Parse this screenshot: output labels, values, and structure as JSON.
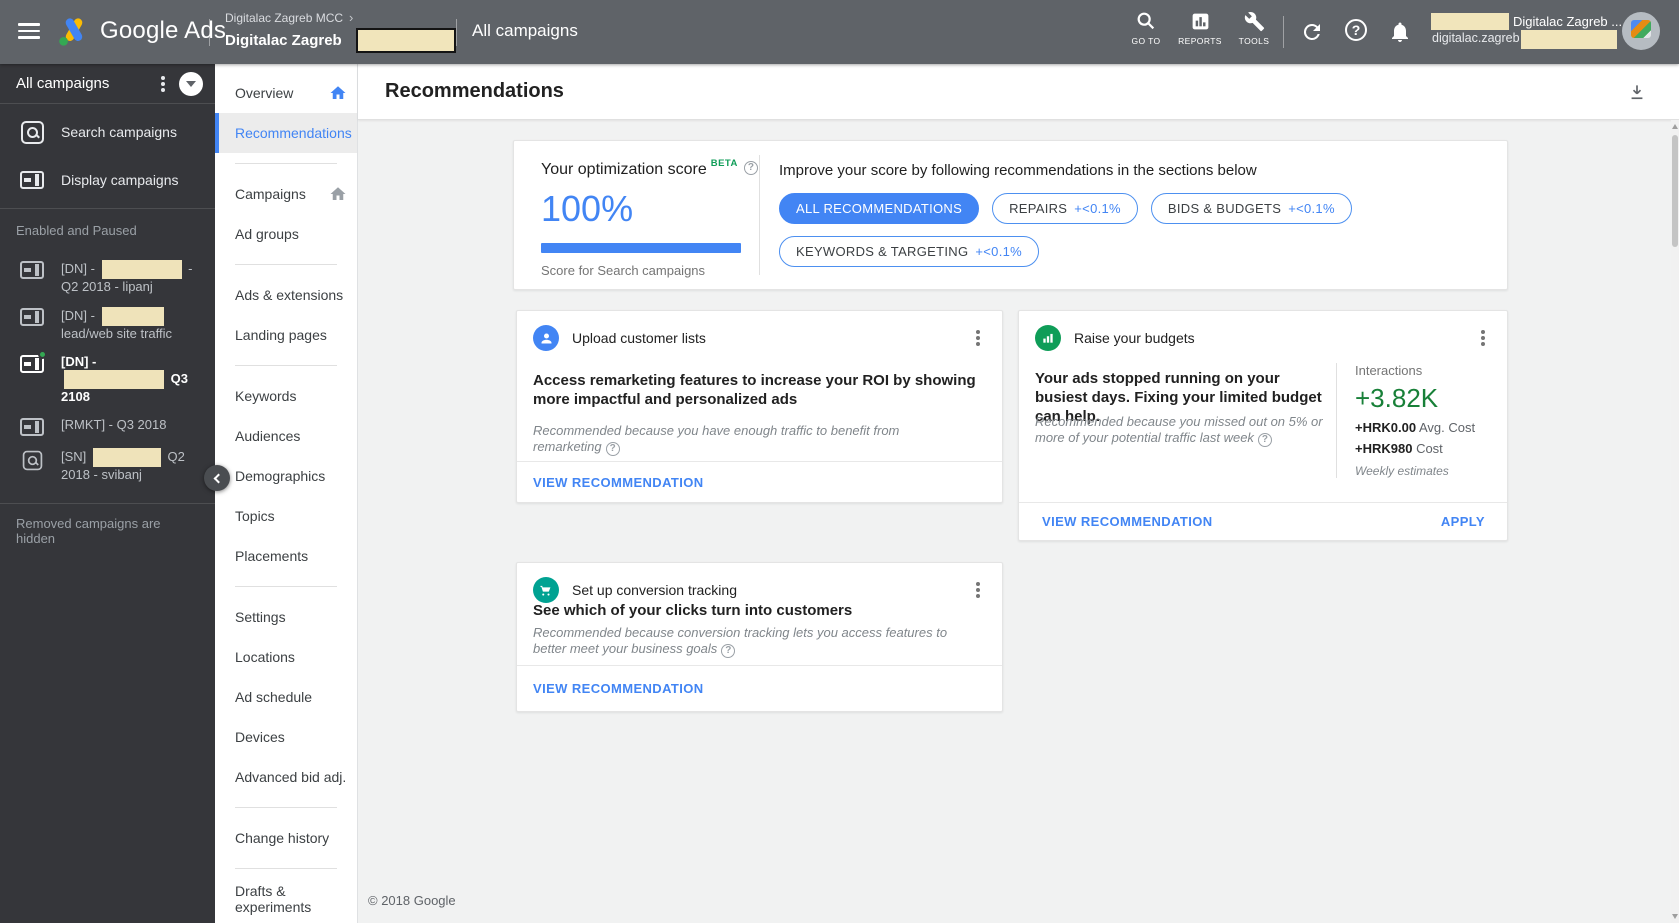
{
  "topbar": {
    "brand": "Google Ads",
    "breadcrumb": {
      "parent": "Digitalac Zagreb MCC",
      "chevron": "›",
      "current": "Digitalac Zagreb"
    },
    "section_title": "All campaigns",
    "nav_tools": [
      {
        "id": "goto",
        "icon": "search-icon",
        "label": "GO TO"
      },
      {
        "id": "reports",
        "icon": "bar-chart-icon",
        "label": "REPORTS"
      },
      {
        "id": "tools",
        "icon": "wrench-icon",
        "label": "TOOLS"
      }
    ],
    "account": {
      "display_name": "Digitalac Zagreb ...",
      "email_prefix": "digitalac.zagreb"
    }
  },
  "campaign_panel": {
    "header_title": "All campaigns",
    "filters": [
      {
        "label": "Search campaigns",
        "type": "search"
      },
      {
        "label": "Display campaigns",
        "type": "display"
      }
    ],
    "section_label": "Enabled and Paused",
    "campaigns": [
      {
        "icon": "display",
        "before": "[DN] -",
        "redacted": true,
        "redact_w": 80,
        "after": "- Q2 2018 - lipanj",
        "active": false
      },
      {
        "icon": "display",
        "before": "[DN] -",
        "redacted": true,
        "redact_w": 62,
        "after": "lead/web site traffic",
        "active": false
      },
      {
        "icon": "display",
        "before": "[DN] -",
        "redacted": true,
        "redact_w": 100,
        "after": "Q3 2108",
        "active": true
      },
      {
        "icon": "display",
        "before": "[RMKT] - Q3 2018",
        "redacted": false,
        "redact_w": 0,
        "after": "",
        "active": false
      },
      {
        "icon": "search",
        "before": "[SN]",
        "redacted": true,
        "redact_w": 68,
        "after": "Q2 2018 - svibanj",
        "active": false
      }
    ],
    "note": "Removed campaigns are hidden"
  },
  "side_nav": {
    "items": [
      {
        "label": "Overview",
        "home": "blue"
      },
      {
        "label": "Recommendations",
        "selected": true
      },
      {
        "divider": true
      },
      {
        "label": "Campaigns",
        "home": "gray"
      },
      {
        "label": "Ad groups"
      },
      {
        "divider": true
      },
      {
        "label": "Ads & extensions"
      },
      {
        "label": "Landing pages"
      },
      {
        "divider": true
      },
      {
        "label": "Keywords"
      },
      {
        "label": "Audiences"
      },
      {
        "label": "Demographics"
      },
      {
        "label": "Topics"
      },
      {
        "label": "Placements"
      },
      {
        "divider": true
      },
      {
        "label": "Settings"
      },
      {
        "label": "Locations"
      },
      {
        "label": "Ad schedule"
      },
      {
        "label": "Devices"
      },
      {
        "label": "Advanced bid adj."
      },
      {
        "divider": true
      },
      {
        "label": "Change history"
      },
      {
        "divider": true
      },
      {
        "label": "Drafts & experiments"
      }
    ]
  },
  "page": {
    "title": "Recommendations",
    "copyright": "© 2018 Google"
  },
  "score_card": {
    "title": "Your optimization score",
    "beta_tag": "BETA",
    "score": "100%",
    "caption": "Score for Search campaigns",
    "improve_heading": "Improve your score by following recommendations in the sections below",
    "chips": [
      {
        "label": "ALL RECOMMENDATIONS",
        "delta": "",
        "selected": true
      },
      {
        "label": "REPAIRS",
        "delta": "+<0.1%",
        "selected": false
      },
      {
        "label": "BIDS & BUDGETS",
        "delta": "+<0.1%",
        "selected": false
      },
      {
        "label": "KEYWORDS & TARGETING",
        "delta": "+<0.1%",
        "selected": false
      }
    ]
  },
  "cards": {
    "upload": {
      "title": "Upload customer lists",
      "heading": "Access remarketing features to increase your ROI by showing more impactful and personalized ads",
      "reason": "Recommended because you have enough traffic to benefit from remarketing",
      "action": "VIEW RECOMMENDATION"
    },
    "budget": {
      "title": "Raise your budgets",
      "heading": "Your ads stopped running on your busiest days. Fixing your limited budget can help.",
      "reason": "Recommended because you missed out on 5% or more of your potential traffic last week",
      "stats": {
        "label": "Interactions",
        "value": "+3.82K",
        "rows": [
          {
            "strong": "+HRK0.00",
            "rest": " Avg. Cost"
          },
          {
            "strong": "+HRK980",
            "rest": " Cost"
          }
        ],
        "note": "Weekly estimates"
      },
      "action": "VIEW RECOMMENDATION",
      "apply": "APPLY"
    },
    "conversion": {
      "title": "Set up conversion tracking",
      "heading": "See which of your clicks turn into customers",
      "reason": "Recommended because conversion tracking lets you access features to better meet your business goals",
      "action": "VIEW RECOMMENDATION"
    }
  },
  "colors": {
    "accent_blue": "#4285f4",
    "success_green": "#188038",
    "beta_green": "#0f9d58",
    "conversion_teal": "#00a292",
    "topbar_gray": "#5f6368"
  }
}
